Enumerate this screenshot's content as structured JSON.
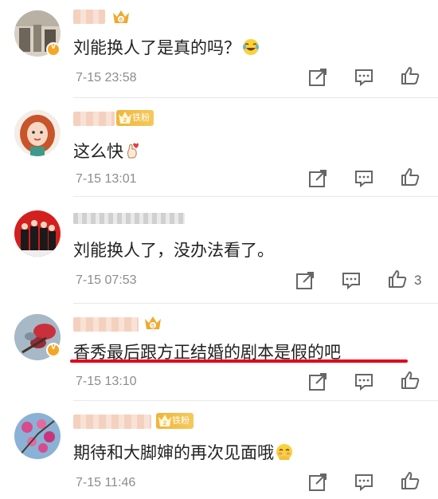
{
  "comments": [
    {
      "text": "刘能换人了是真的吗？",
      "emoji": "laughing-crying-emoji",
      "time": "7-15 23:58",
      "likes": ""
    },
    {
      "text": "这么快",
      "emoji": "finger-heart-emoji",
      "time": "7-15 13:01",
      "likes": "",
      "badge": "铁粉"
    },
    {
      "text": "刘能换人了，没办法看了。",
      "emoji": "",
      "time": "7-15 07:53",
      "likes": "3"
    },
    {
      "text": "香秀最后跟方正结婚的剧本是假的吧",
      "emoji": "",
      "time": "7-15 13:10",
      "likes": ""
    },
    {
      "text": "期待和大脚婶的再次见面哦",
      "emoji": "shy-emoji",
      "time": "7-15 11:46",
      "likes": "",
      "badge": "铁粉"
    }
  ],
  "colors": {
    "highlight_underline": "#e0001b",
    "badge": "#f0b43c",
    "timestamp": "#8c8c8c"
  }
}
